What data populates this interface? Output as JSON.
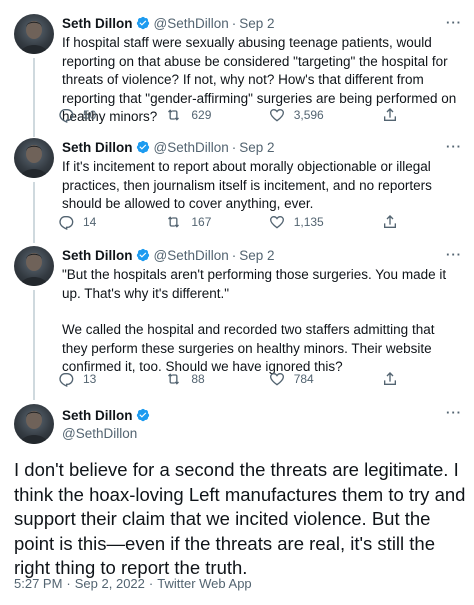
{
  "colors": {
    "verified_blue": "#1d9bf0",
    "text_primary": "#0f1419",
    "text_secondary": "#536471",
    "thread_line": "#cfd9de"
  },
  "tweets": [
    {
      "name": "Seth Dillon",
      "handle": "@SethDillon",
      "separator": "·",
      "date": "Sep 2",
      "paragraphs": [
        "If hospital staff were sexually abusing teenage patients, would reporting on that abuse be considered \"targeting\" the hospital for threats of violence? If not, why not? How's that different from reporting that \"gender-affirming\" surgeries are being performed on healthy minors?"
      ],
      "replies": "50",
      "retweets": "629",
      "likes": "3,596"
    },
    {
      "name": "Seth Dillon",
      "handle": "@SethDillon",
      "separator": "·",
      "date": "Sep 2",
      "paragraphs": [
        "If it's incitement to report about morally objectionable or illegal practices, then journalism itself is incitement, and no reporters should be allowed to cover anything, ever."
      ],
      "replies": "14",
      "retweets": "167",
      "likes": "1,135"
    },
    {
      "name": "Seth Dillon",
      "handle": "@SethDillon",
      "separator": "·",
      "date": "Sep 2",
      "paragraphs": [
        "\"But the hospitals aren't performing those surgeries. You made it up. That's why it's different.\"",
        "We called the hospital and recorded two staffers admitting that they perform these surgeries on healthy minors. Their website confirmed it, too. Should we have ignored this?"
      ],
      "replies": "13",
      "retweets": "88",
      "likes": "784"
    }
  ],
  "main_tweet": {
    "name": "Seth Dillon",
    "handle": "@SethDillon",
    "text": "I don't believe for a second the threats are legitimate. I think the hoax-loving Left manufactures them to try and support their claim that we incited violence. But the point is this—even if the threats are real, it's still the right thing to report the truth.",
    "time": "5:27 PM",
    "separator": "·",
    "date": "Sep 2, 2022",
    "source": "Twitter Web App"
  },
  "more_label": "···"
}
